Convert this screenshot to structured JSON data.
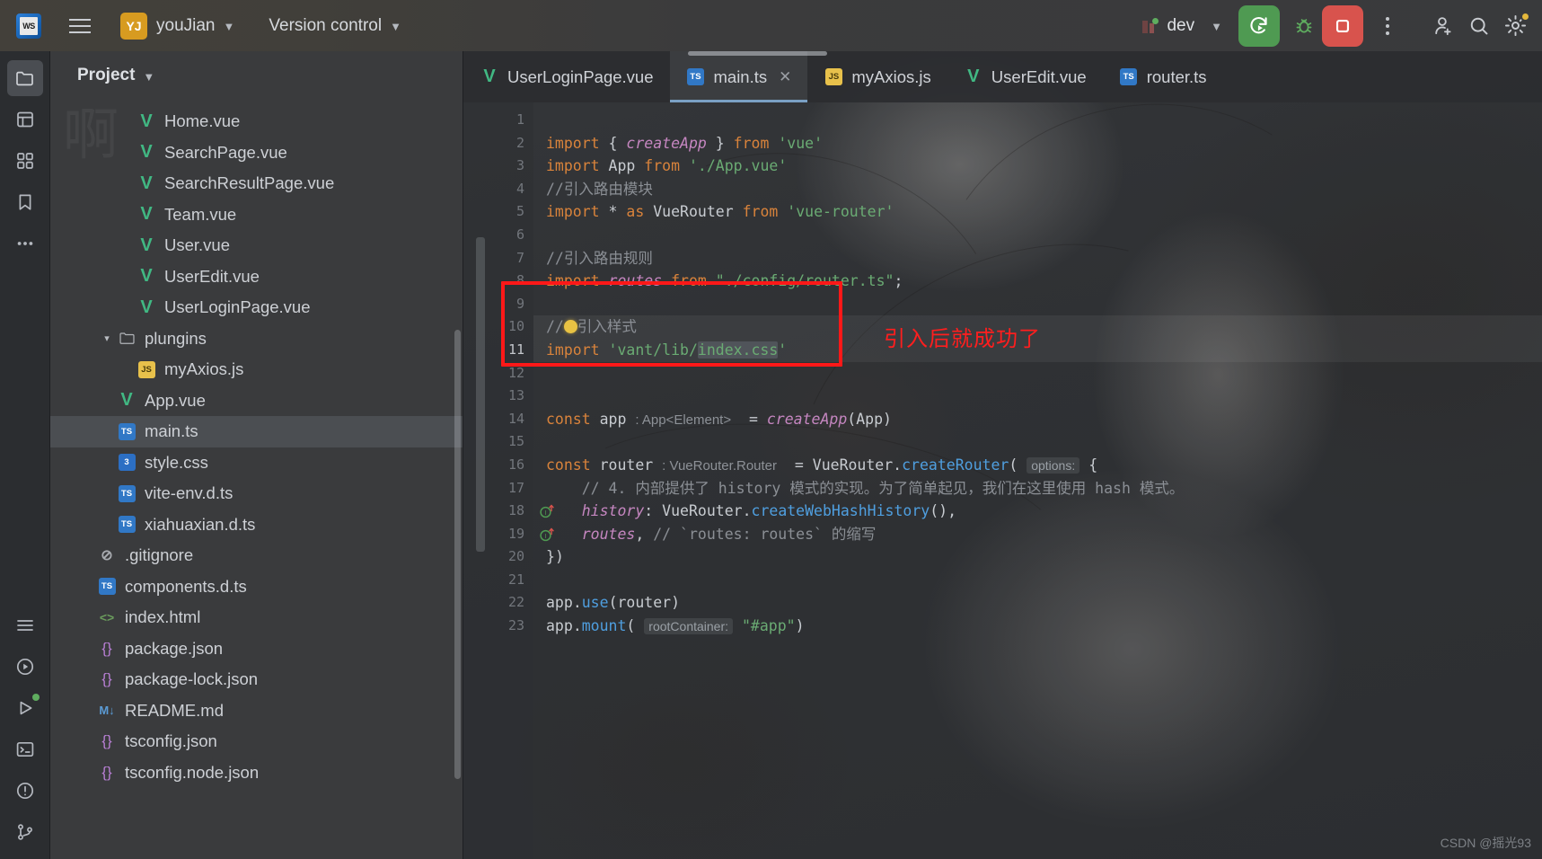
{
  "titlebar": {
    "app_icon": "webstorm-logo-icon",
    "menu_icon": "hamburger-menu-icon",
    "project_initials": "YJ",
    "project_name": "youJian",
    "version_control_label": "Version control",
    "run_config_name": "dev",
    "run_icon": "run-with-restart-icon",
    "debug_icon": "bug-icon",
    "stop_icon": "stop-square-icon",
    "more_icon": "kebab-more-icon",
    "account_icon": "add-user-icon",
    "search_icon": "search-icon",
    "settings_icon": "gear-icon",
    "accent_green": "#4f9a52",
    "accent_red": "#d8534d",
    "accent_yellow": "#d79b20"
  },
  "activitybar": {
    "items": [
      {
        "name": "project-tool-window",
        "icon": "folder-icon",
        "selected": true
      },
      {
        "name": "structure-tool-window",
        "icon": "structure-icon",
        "selected": false
      },
      {
        "name": "modules-tool-window",
        "icon": "grid-modules-icon",
        "selected": false
      },
      {
        "name": "bookmarks-tool-window",
        "icon": "bookmark-icon",
        "selected": false
      },
      {
        "name": "more-tool-windows",
        "icon": "ellipsis-icon",
        "selected": false
      }
    ],
    "bottom_items": [
      {
        "name": "todo-tool-window",
        "icon": "list-icon"
      },
      {
        "name": "run-tool-window",
        "icon": "play-circle-icon"
      },
      {
        "name": "services-tool-window",
        "icon": "play-outline-icon"
      },
      {
        "name": "terminal-tool-window",
        "icon": "terminal-icon"
      },
      {
        "name": "problems-tool-window",
        "icon": "warning-circle-icon"
      },
      {
        "name": "version-control-tool-window",
        "icon": "git-branch-icon"
      }
    ]
  },
  "project_panel": {
    "title": "Project",
    "watermark": "啊",
    "tree": [
      {
        "indent": 3,
        "icon": "vue",
        "label": "Home.vue",
        "selected": false,
        "arrow": ""
      },
      {
        "indent": 3,
        "icon": "vue",
        "label": "SearchPage.vue",
        "selected": false,
        "arrow": ""
      },
      {
        "indent": 3,
        "icon": "vue",
        "label": "SearchResultPage.vue",
        "selected": false,
        "arrow": ""
      },
      {
        "indent": 3,
        "icon": "vue",
        "label": "Team.vue",
        "selected": false,
        "arrow": ""
      },
      {
        "indent": 3,
        "icon": "vue",
        "label": "User.vue",
        "selected": false,
        "arrow": ""
      },
      {
        "indent": 3,
        "icon": "vue",
        "label": "UserEdit.vue",
        "selected": false,
        "arrow": ""
      },
      {
        "indent": 3,
        "icon": "vue",
        "label": "UserLoginPage.vue",
        "selected": false,
        "arrow": ""
      },
      {
        "indent": 2,
        "icon": "folder",
        "label": "plungins",
        "selected": false,
        "arrow": "v"
      },
      {
        "indent": 3,
        "icon": "js",
        "label": "myAxios.js",
        "selected": false,
        "arrow": ""
      },
      {
        "indent": 2,
        "icon": "vue",
        "label": "App.vue",
        "selected": false,
        "arrow": ""
      },
      {
        "indent": 2,
        "icon": "ts",
        "label": "main.ts",
        "selected": true,
        "arrow": ""
      },
      {
        "indent": 2,
        "icon": "css",
        "label": "style.css",
        "selected": false,
        "arrow": ""
      },
      {
        "indent": 2,
        "icon": "ts",
        "label": "vite-env.d.ts",
        "selected": false,
        "arrow": ""
      },
      {
        "indent": 2,
        "icon": "ts",
        "label": "xiahuaxian.d.ts",
        "selected": false,
        "arrow": ""
      },
      {
        "indent": 1,
        "icon": "git",
        "label": ".gitignore",
        "selected": false,
        "arrow": ""
      },
      {
        "indent": 1,
        "icon": "ts",
        "label": "components.d.ts",
        "selected": false,
        "arrow": ""
      },
      {
        "indent": 1,
        "icon": "html",
        "label": "index.html",
        "selected": false,
        "arrow": ""
      },
      {
        "indent": 1,
        "icon": "json",
        "label": "package.json",
        "selected": false,
        "arrow": ""
      },
      {
        "indent": 1,
        "icon": "json",
        "label": "package-lock.json",
        "selected": false,
        "arrow": ""
      },
      {
        "indent": 1,
        "icon": "md",
        "label": "README.md",
        "selected": false,
        "arrow": ""
      },
      {
        "indent": 1,
        "icon": "json",
        "label": "tsconfig.json",
        "selected": false,
        "arrow": ""
      },
      {
        "indent": 1,
        "icon": "json",
        "label": "tsconfig.node.json",
        "selected": false,
        "arrow": ""
      }
    ]
  },
  "editor": {
    "tabs": [
      {
        "label": "UserLoginPage.vue",
        "icon": "vue",
        "active": false,
        "closable": false
      },
      {
        "label": "main.ts",
        "icon": "ts",
        "active": true,
        "closable": true
      },
      {
        "label": "myAxios.js",
        "icon": "js",
        "active": false,
        "closable": false
      },
      {
        "label": "UserEdit.vue",
        "icon": "vue",
        "active": false,
        "closable": false
      },
      {
        "label": "router.ts",
        "icon": "ts",
        "active": false,
        "closable": false
      }
    ],
    "file_language": "TypeScript",
    "lines": [
      {
        "n": 1,
        "text": ""
      },
      {
        "n": 2,
        "text": "import { createApp } from 'vue'"
      },
      {
        "n": 3,
        "text": "import App from './App.vue'"
      },
      {
        "n": 4,
        "text": "//引入路由模块"
      },
      {
        "n": 5,
        "text": "import * as VueRouter from 'vue-router'"
      },
      {
        "n": 6,
        "text": ""
      },
      {
        "n": 7,
        "text": "//引入路由规则"
      },
      {
        "n": 8,
        "text": "import routes from \"./config/router.ts\";"
      },
      {
        "n": 9,
        "text": ""
      },
      {
        "n": 10,
        "text": "//引入样式"
      },
      {
        "n": 11,
        "text": "import 'vant/lib/index.css'"
      },
      {
        "n": 12,
        "text": ""
      },
      {
        "n": 13,
        "text": ""
      },
      {
        "n": 14,
        "text": "const app : App<Element>  = createApp(App)"
      },
      {
        "n": 15,
        "text": ""
      },
      {
        "n": 16,
        "text": "const router : VueRouter.Router  = VueRouter.createRouter( options: {"
      },
      {
        "n": 17,
        "text": "    // 4. 内部提供了 history 模式的实现。为了简单起见，我们在这里使用 hash 模式。"
      },
      {
        "n": 18,
        "text": "    history: VueRouter.createWebHashHistory(),"
      },
      {
        "n": 19,
        "text": "    routes, // `routes: routes` 的缩写"
      },
      {
        "n": 20,
        "text": "})"
      },
      {
        "n": 21,
        "text": ""
      },
      {
        "n": 22,
        "text": "app.use(router)"
      },
      {
        "n": 23,
        "text": "app.mount( rootContainer: \"#app\")"
      }
    ],
    "current_line": 11,
    "gutter_markers": [
      {
        "line": 18,
        "icon": "interface-implemented-icon"
      },
      {
        "line": 19,
        "icon": "interface-implemented-icon"
      }
    ],
    "intention_bulb": {
      "line": 10,
      "icon": "lightbulb-icon"
    },
    "selected_token": "index.css",
    "annotation": {
      "text": "引入后就成功了",
      "color": "#ff1e1e"
    },
    "highlight_box_color": "#ff1818",
    "watermark": "CSDN @摇光93"
  }
}
